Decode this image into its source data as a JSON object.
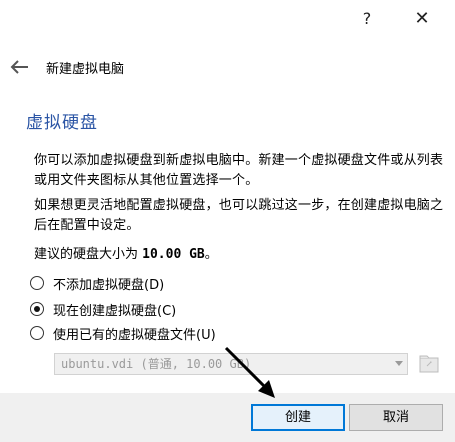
{
  "titlebar": {
    "help_label": "?",
    "close_label": "✕"
  },
  "wizard": {
    "title": "新建虚拟电脑",
    "back_icon": "back-arrow-icon"
  },
  "page": {
    "heading": "虚拟硬盘",
    "para1": "你可以添加虚拟硬盘到新虚拟电脑中。新建一个虚拟硬盘文件或从列表或用文件夹图标从其他位置选择一个。",
    "para2": "如果想更灵活地配置虚拟硬盘，也可以跳过这一步，在创建虚拟电脑之后在配置中设定。",
    "size_prefix": "建议的硬盘大小为 ",
    "size_value": "10.00 GB",
    "size_suffix": "。"
  },
  "options": [
    {
      "label": "不添加虚拟硬盘(D)",
      "checked": false
    },
    {
      "label": "现在创建虚拟硬盘(C)",
      "checked": true
    },
    {
      "label": "使用已有的虚拟硬盘文件(U)",
      "checked": false
    }
  ],
  "disk_select": {
    "value": "ubuntu.vdi (普通, 10.00 GB)",
    "enabled": false
  },
  "buttons": {
    "create": "创建",
    "cancel": "取消"
  },
  "colors": {
    "heading": "#2b55a5",
    "default_button_border": "#0078d7",
    "footer_bg": "#f0f0f0"
  }
}
